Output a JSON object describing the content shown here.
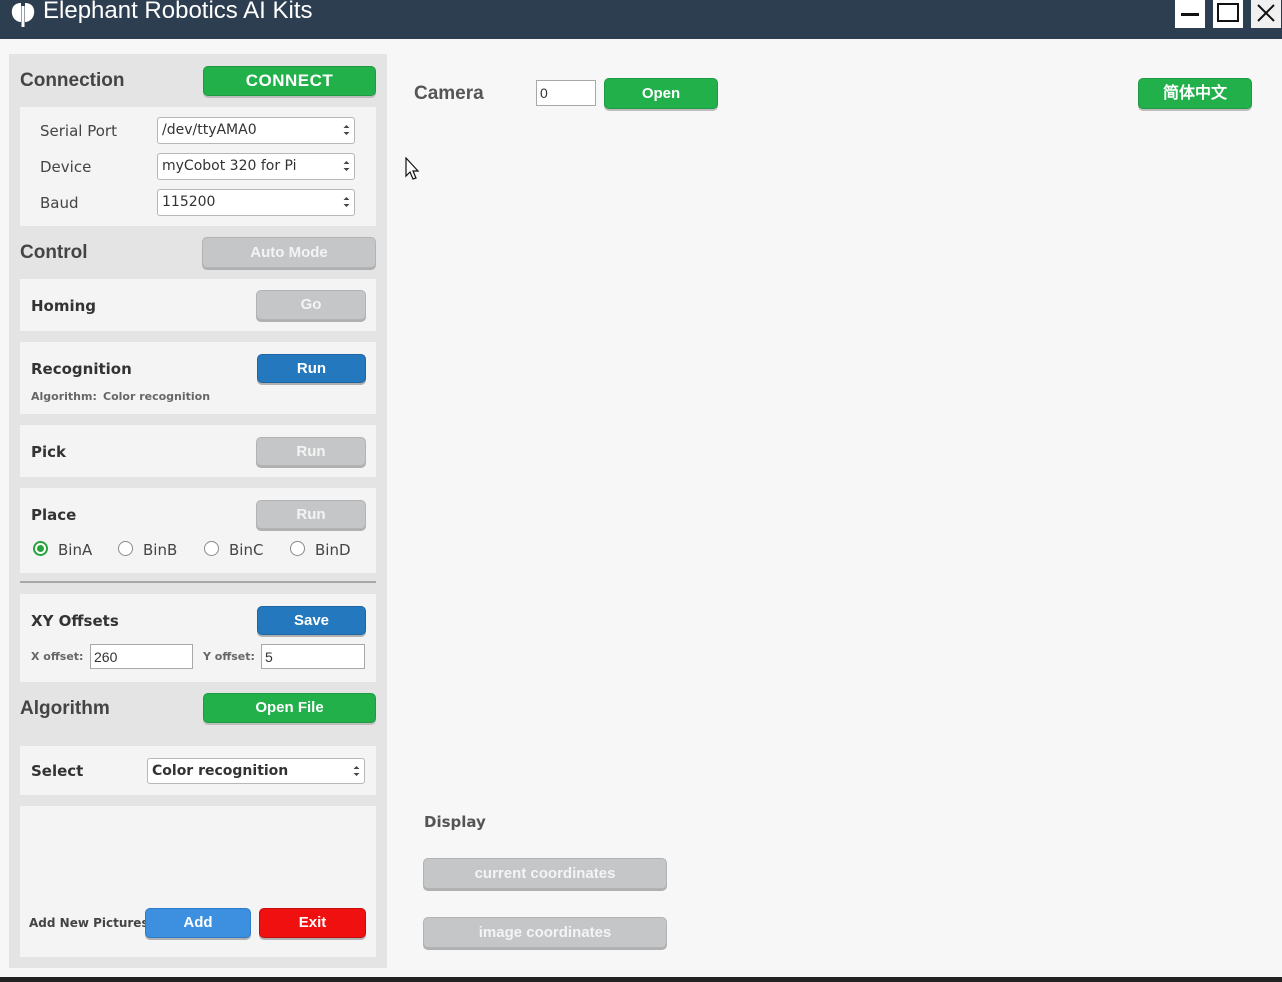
{
  "window": {
    "title": "Elephant Robotics AI Kits"
  },
  "connection": {
    "title": "Connection",
    "connect_label": "CONNECT",
    "fields": [
      {
        "label": "Serial Port",
        "value": "/dev/ttyAMA0"
      },
      {
        "label": "Device",
        "value": "myCobot 320 for Pi"
      },
      {
        "label": "Baud",
        "value": "115200"
      }
    ]
  },
  "control": {
    "title": "Control",
    "auto_mode_label": "Auto Mode",
    "homing": {
      "label": "Homing",
      "button": "Go"
    },
    "recognition": {
      "label": "Recognition",
      "button": "Run",
      "algorithm_label": "Algorithm:",
      "algorithm_value": "Color recognition"
    },
    "pick": {
      "label": "Pick",
      "button": "Run"
    },
    "place": {
      "label": "Place",
      "button": "Run",
      "bins": [
        "BinA",
        "BinB",
        "BinC",
        "BinD"
      ],
      "selected": "BinA"
    },
    "xy_offsets": {
      "label": "XY Offsets",
      "button": "Save",
      "x_label": "X offset:",
      "x_value": "260",
      "y_label": "Y offset:",
      "y_value": "5"
    }
  },
  "algorithm": {
    "title": "Algorithm",
    "open_file_label": "Open File",
    "select_label": "Select",
    "select_value": "Color recognition",
    "add_pictures_label": "Add New Pictures",
    "add_label": "Add",
    "exit_label": "Exit"
  },
  "camera": {
    "label": "Camera",
    "index_value": "0",
    "open_label": "Open",
    "language_label": "简体中文"
  },
  "display": {
    "label": "Display",
    "current_coordinates_label": "current coordinates",
    "image_coordinates_label": "image coordinates"
  },
  "colors": {
    "titlebar": "#2c3e50",
    "green": "#22b04a",
    "blue": "#2478bd",
    "red": "#f01010",
    "gray_button": "#c4c6c8"
  }
}
